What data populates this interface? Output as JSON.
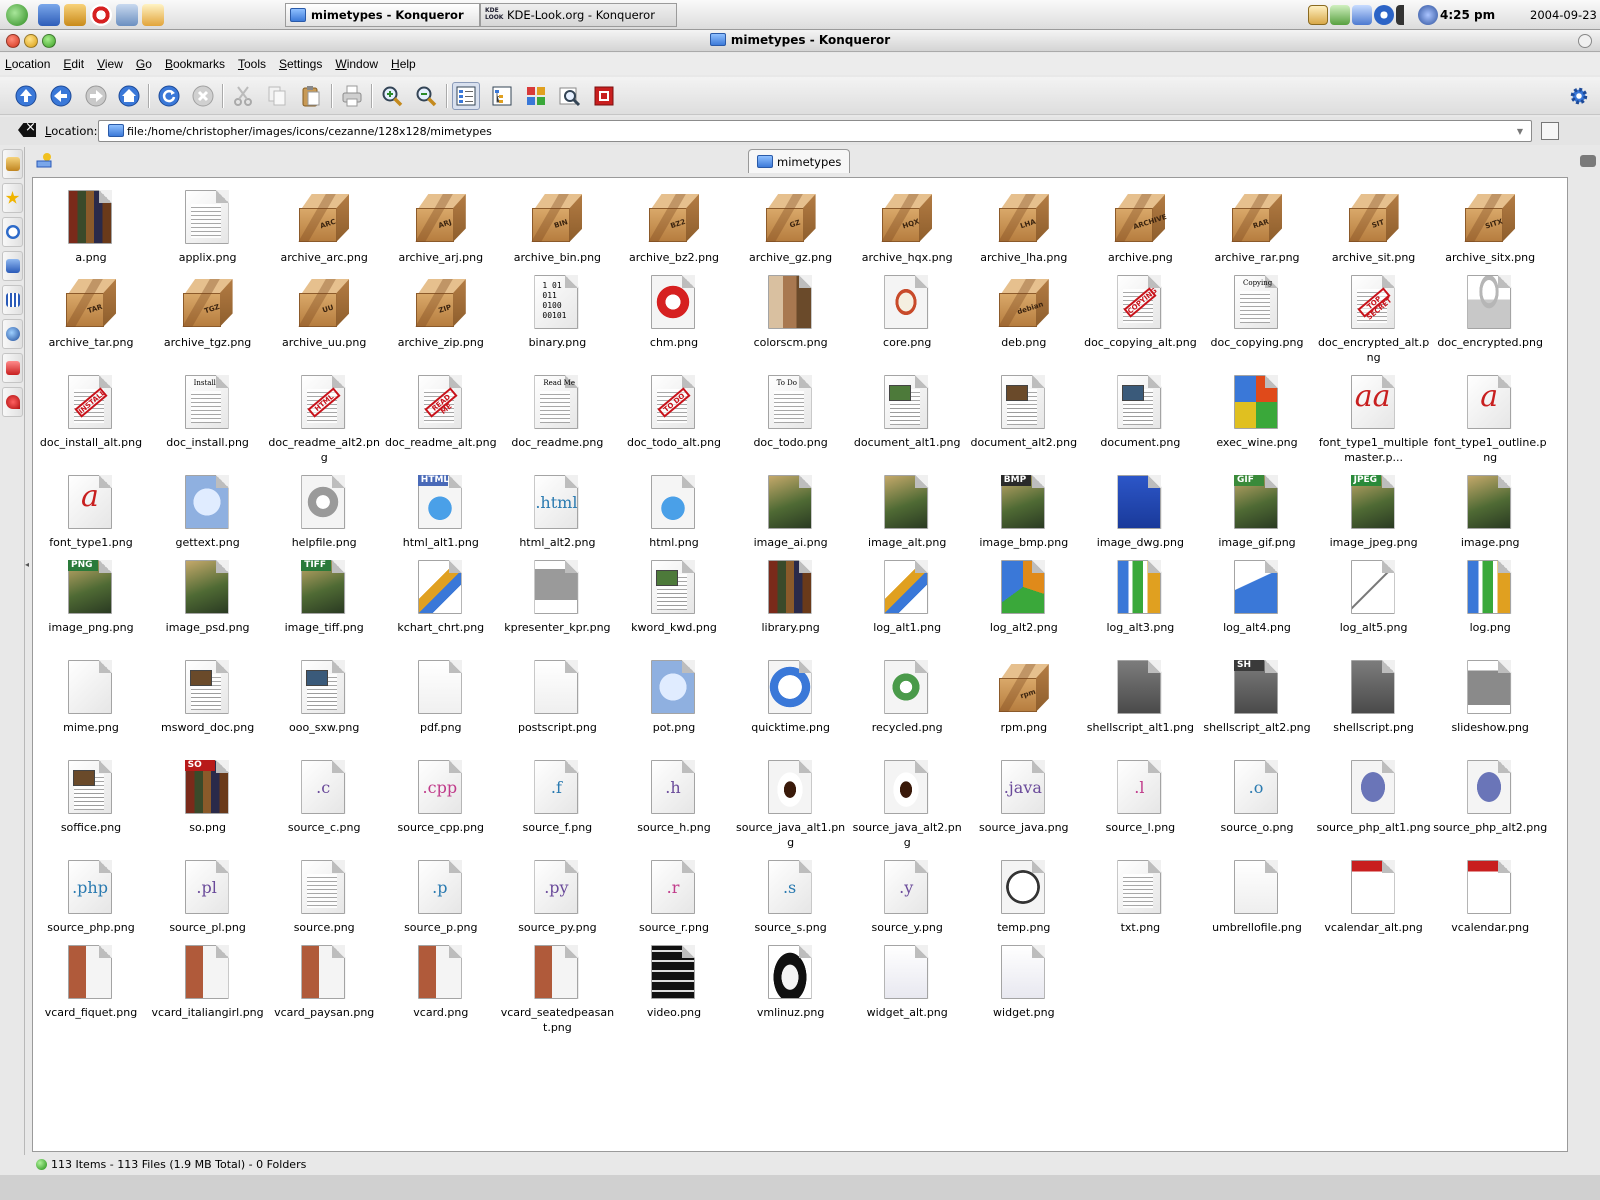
{
  "taskbar": {
    "tasks": [
      {
        "label": "mimetypes - Konqueror",
        "active": true
      },
      {
        "label": "KDE-Look.org - Konqueror",
        "active": false
      }
    ],
    "kdelook_badge": "KDE LOOK",
    "clock": "4:25 pm",
    "date": "2004-09-23"
  },
  "window": {
    "title": "mimetypes - Konqueror"
  },
  "menubar": {
    "items": [
      "Location",
      "Edit",
      "View",
      "Go",
      "Bookmarks",
      "Tools",
      "Settings",
      "Window",
      "Help"
    ]
  },
  "toolbar": {
    "buttons": [
      "up-icon",
      "back-icon",
      "forward-icon",
      "home-icon",
      "reload-icon",
      "stop-icon",
      "cut-icon",
      "copy-icon",
      "paste-icon",
      "print-icon",
      "zoom-in-icon",
      "zoom-out-icon",
      "icon-view-icon",
      "tree-view-icon",
      "multicolumn-view-icon",
      "search-icon",
      "security-icon",
      "gear-icon"
    ]
  },
  "location": {
    "label": "Location:",
    "value": "file:/home/christopher/images/icons/cezanne/128x128/mimetypes"
  },
  "tabs": [
    {
      "label": "mimetypes"
    }
  ],
  "files": [
    {
      "name": "a.png",
      "icon": "book-icon"
    },
    {
      "name": "applix.png",
      "icon": "document-icon"
    },
    {
      "name": "archive_arc.png",
      "icon": "box-icon",
      "tag": "ARC"
    },
    {
      "name": "archive_arj.png",
      "icon": "box-icon",
      "tag": "ARJ"
    },
    {
      "name": "archive_bin.png",
      "icon": "box-icon",
      "tag": "BIN"
    },
    {
      "name": "archive_bz2.png",
      "icon": "box-icon",
      "tag": "BZ2"
    },
    {
      "name": "archive_gz.png",
      "icon": "box-icon",
      "tag": "GZ"
    },
    {
      "name": "archive_hqx.png",
      "icon": "box-icon",
      "tag": "HQX"
    },
    {
      "name": "archive_lha.png",
      "icon": "box-icon",
      "tag": "LHA"
    },
    {
      "name": "archive.png",
      "icon": "box-icon",
      "tag": "ARCHIVE"
    },
    {
      "name": "archive_rar.png",
      "icon": "box-icon",
      "tag": "RAR"
    },
    {
      "name": "archive_sit.png",
      "icon": "box-icon",
      "tag": "SIT"
    },
    {
      "name": "archive_sitx.png",
      "icon": "box-icon",
      "tag": "SITX"
    },
    {
      "name": "archive_tar.png",
      "icon": "box-icon",
      "tag": "TAR"
    },
    {
      "name": "archive_tgz.png",
      "icon": "box-icon",
      "tag": "TGZ"
    },
    {
      "name": "archive_uu.png",
      "icon": "box-icon",
      "tag": "UU"
    },
    {
      "name": "archive_zip.png",
      "icon": "box-icon",
      "tag": "ZIP"
    },
    {
      "name": "binary.png",
      "icon": "binary-icon",
      "ext": "1 01 011 0100 00101"
    },
    {
      "name": "chm.png",
      "icon": "lifebuoy-icon"
    },
    {
      "name": "colorscm.png",
      "icon": "color-swatch-icon"
    },
    {
      "name": "core.png",
      "icon": "apple-core-icon"
    },
    {
      "name": "deb.png",
      "icon": "box-icon",
      "tag": "debian"
    },
    {
      "name": "doc_copying_alt.png",
      "icon": "document-icon",
      "stamp": "COPYING"
    },
    {
      "name": "doc_copying.png",
      "icon": "document-icon",
      "ext": "Copying"
    },
    {
      "name": "doc_encrypted_alt.png",
      "icon": "document-icon",
      "stamp": "TOP SECRET"
    },
    {
      "name": "doc_encrypted.png",
      "icon": "padlock-icon"
    },
    {
      "name": "doc_install_alt.png",
      "icon": "document-icon",
      "stamp": "INSTALL"
    },
    {
      "name": "doc_install.png",
      "icon": "document-icon",
      "ext": "Install"
    },
    {
      "name": "doc_readme_alt2.png",
      "icon": "document-icon",
      "stamp": "HTML"
    },
    {
      "name": "doc_readme_alt.png",
      "icon": "document-icon",
      "stamp": "READ ME"
    },
    {
      "name": "doc_readme.png",
      "icon": "document-icon",
      "ext": "Read Me"
    },
    {
      "name": "doc_todo_alt.png",
      "icon": "document-icon",
      "stamp": "TO DO"
    },
    {
      "name": "doc_todo.png",
      "icon": "document-icon",
      "ext": "To Do"
    },
    {
      "name": "document_alt1.png",
      "icon": "document-icon",
      "pic": true
    },
    {
      "name": "document_alt2.png",
      "icon": "document-icon",
      "pic": true
    },
    {
      "name": "document.png",
      "icon": "document-icon",
      "pic": true
    },
    {
      "name": "exec_wine.png",
      "icon": "windows-flag-icon"
    },
    {
      "name": "font_type1_multiplemaster.p...",
      "icon": "font-icon",
      "ext": "aa"
    },
    {
      "name": "font_type1_outline.png",
      "icon": "font-icon",
      "ext": "a"
    },
    {
      "name": "font_type1.png",
      "icon": "font-icon",
      "ext": "a"
    },
    {
      "name": "gettext.png",
      "icon": "globe-document-icon"
    },
    {
      "name": "helpfile.png",
      "icon": "help-icon"
    },
    {
      "name": "html_alt1.png",
      "icon": "globe-icon",
      "band": "HTML"
    },
    {
      "name": "html_alt2.png",
      "icon": "document-icon",
      "ext": ".html"
    },
    {
      "name": "html.png",
      "icon": "globe-icon"
    },
    {
      "name": "image_ai.png",
      "icon": "image-icon"
    },
    {
      "name": "image_alt.png",
      "icon": "image-icon"
    },
    {
      "name": "image_bmp.png",
      "icon": "image-icon",
      "band": "BMP"
    },
    {
      "name": "image_dwg.png",
      "icon": "blueprint-icon"
    },
    {
      "name": "image_gif.png",
      "icon": "image-icon",
      "band": "GIF"
    },
    {
      "name": "image_jpeg.png",
      "icon": "image-icon",
      "band": "JPEG"
    },
    {
      "name": "image.png",
      "icon": "image-icon"
    },
    {
      "name": "image_png.png",
      "icon": "image-icon",
      "band": "PNG"
    },
    {
      "name": "image_psd.png",
      "icon": "image-icon"
    },
    {
      "name": "image_tiff.png",
      "icon": "image-icon",
      "band": "TIFF"
    },
    {
      "name": "kchart_chrt.png",
      "icon": "chart-icon"
    },
    {
      "name": "kpresenter_kpr.png",
      "icon": "presentation-icon"
    },
    {
      "name": "kword_kwd.png",
      "icon": "document-icon",
      "pic": true
    },
    {
      "name": "library.png",
      "icon": "book-icon"
    },
    {
      "name": "log_alt1.png",
      "icon": "chart-icon"
    },
    {
      "name": "log_alt2.png",
      "icon": "pie-chart-icon"
    },
    {
      "name": "log_alt3.png",
      "icon": "bar-chart-icon"
    },
    {
      "name": "log_alt4.png",
      "icon": "area-chart-icon"
    },
    {
      "name": "log_alt5.png",
      "icon": "line-chart-icon"
    },
    {
      "name": "log.png",
      "icon": "bar-chart-icon"
    },
    {
      "name": "mime.png",
      "icon": "blank-document-icon"
    },
    {
      "name": "msword_doc.png",
      "icon": "document-icon",
      "pic": true
    },
    {
      "name": "ooo_sxw.png",
      "icon": "document-icon",
      "pic": true
    },
    {
      "name": "pdf.png",
      "icon": "acrobat-icon"
    },
    {
      "name": "postscript.png",
      "icon": "postscript-icon"
    },
    {
      "name": "pot.png",
      "icon": "globe-document-icon"
    },
    {
      "name": "quicktime.png",
      "icon": "quicktime-icon"
    },
    {
      "name": "recycled.png",
      "icon": "recycle-icon"
    },
    {
      "name": "rpm.png",
      "icon": "box-icon",
      "tag": "rpm"
    },
    {
      "name": "shellscript_alt1.png",
      "icon": "terminal-icon"
    },
    {
      "name": "shellscript_alt2.png",
      "icon": "terminal-icon",
      "band": "SH"
    },
    {
      "name": "shellscript.png",
      "icon": "terminal-icon"
    },
    {
      "name": "slideshow.png",
      "icon": "slideshow-icon"
    },
    {
      "name": "soffice.png",
      "icon": "document-icon",
      "pic": true
    },
    {
      "name": "so.png",
      "icon": "book-icon",
      "band": "SO"
    },
    {
      "name": "source_c.png",
      "icon": "document-icon",
      "ext": ".c"
    },
    {
      "name": "source_cpp.png",
      "icon": "document-icon",
      "ext": ".cpp"
    },
    {
      "name": "source_f.png",
      "icon": "document-icon",
      "ext": ".f"
    },
    {
      "name": "source_h.png",
      "icon": "document-icon",
      "ext": ".h"
    },
    {
      "name": "source_java_alt1.png",
      "icon": "coffee-cup-icon"
    },
    {
      "name": "source_java_alt2.png",
      "icon": "coffee-cup-icon"
    },
    {
      "name": "source_java.png",
      "icon": "document-icon",
      "ext": ".java"
    },
    {
      "name": "source_l.png",
      "icon": "document-icon",
      "ext": ".l"
    },
    {
      "name": "source_o.png",
      "icon": "document-icon",
      "ext": ".o"
    },
    {
      "name": "source_php_alt1.png",
      "icon": "php-icon"
    },
    {
      "name": "source_php_alt2.png",
      "icon": "php-icon"
    },
    {
      "name": "source_php.png",
      "icon": "document-icon",
      "ext": ".php"
    },
    {
      "name": "source_pl.png",
      "icon": "document-icon",
      "ext": ".pl"
    },
    {
      "name": "source.png",
      "icon": "document-icon"
    },
    {
      "name": "source_p.png",
      "icon": "document-icon",
      "ext": ".p"
    },
    {
      "name": "source_py.png",
      "icon": "document-icon",
      "ext": ".py"
    },
    {
      "name": "source_r.png",
      "icon": "document-icon",
      "ext": ".r"
    },
    {
      "name": "source_s.png",
      "icon": "document-icon",
      "ext": ".s"
    },
    {
      "name": "source_y.png",
      "icon": "document-icon",
      "ext": ".y"
    },
    {
      "name": "temp.png",
      "icon": "clock-icon"
    },
    {
      "name": "txt.png",
      "icon": "document-icon"
    },
    {
      "name": "umbrellofile.png",
      "icon": "diagram-icon"
    },
    {
      "name": "vcalendar_alt.png",
      "icon": "calendar-icon"
    },
    {
      "name": "vcalendar.png",
      "icon": "calendar-icon"
    },
    {
      "name": "vcard_fiquet.png",
      "icon": "vcard-icon"
    },
    {
      "name": "vcard_italiangirl.png",
      "icon": "vcard-icon"
    },
    {
      "name": "vcard_paysan.png",
      "icon": "vcard-icon"
    },
    {
      "name": "vcard.png",
      "icon": "vcard-icon"
    },
    {
      "name": "vcard_seatedpeasant.png",
      "icon": "vcard-icon"
    },
    {
      "name": "video.png",
      "icon": "film-icon"
    },
    {
      "name": "vmlinuz.png",
      "icon": "tux-icon"
    },
    {
      "name": "widget_alt.png",
      "icon": "widget-icon"
    },
    {
      "name": "widget.png",
      "icon": "widget-icon"
    }
  ],
  "status": {
    "text": "113 Items - 113 Files (1.9 MB Total) - 0 Folders"
  },
  "colors": {
    "box_tan": "#d9a869",
    "stamp_red": "#c8121a",
    "status_green": "#1f8d12",
    "selection_blue": "#3d7ad8"
  }
}
